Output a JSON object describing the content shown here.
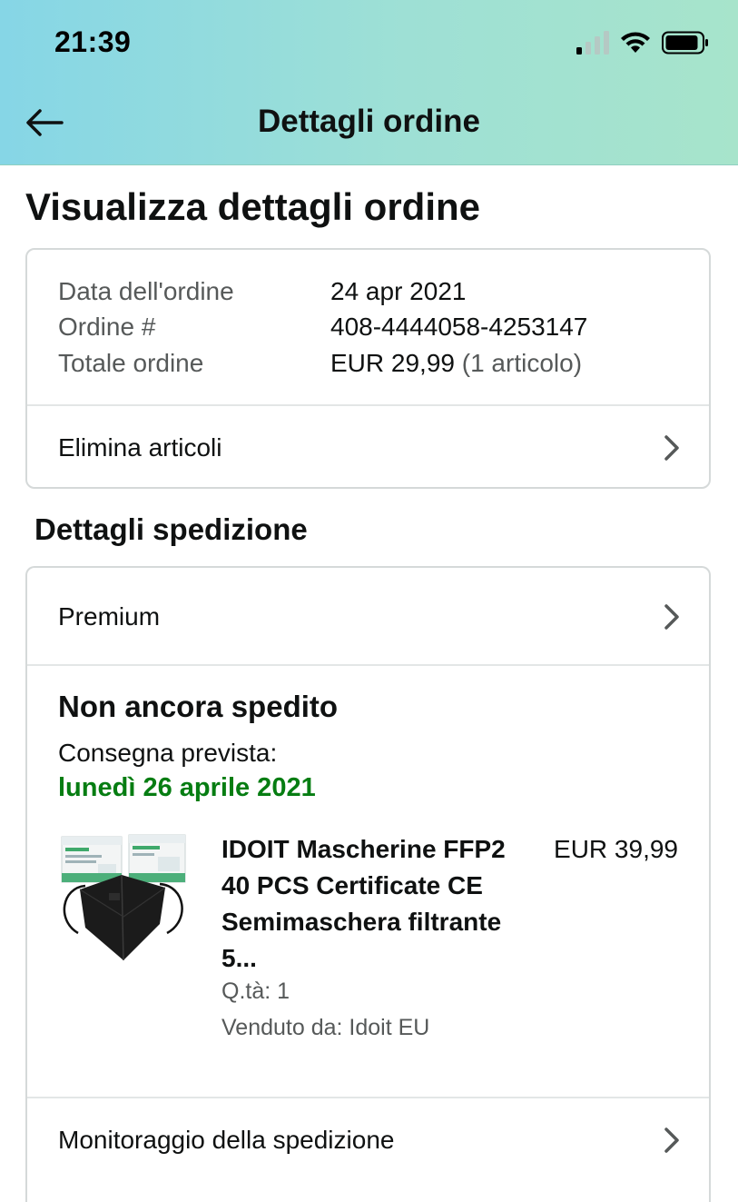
{
  "status_bar": {
    "time": "21:39",
    "signal_icon": "signal-bars-icon",
    "wifi_icon": "wifi-icon",
    "battery_icon": "battery-icon"
  },
  "nav": {
    "title": "Dettagli ordine",
    "back_icon": "back-arrow-icon",
    "background_colors": [
      "#86d6e6",
      "#a7e4cb"
    ]
  },
  "page": {
    "title": "Visualizza dettagli ordine"
  },
  "order_summary": {
    "rows": [
      {
        "label": "Data dell'ordine",
        "value": "24 apr 2021"
      },
      {
        "label": "Ordine #",
        "value": "408-4444058-4253147"
      },
      {
        "label": "Totale ordine",
        "value": "EUR 29,99",
        "note": "(1 articolo)"
      }
    ],
    "delete_items_label": "Elimina articoli"
  },
  "shipping": {
    "section_title": "Dettagli spedizione",
    "shipping_method": "Premium",
    "status": "Non ancora spedito",
    "delivery_label": "Consegna prevista:",
    "delivery_date": "lunedì 26 aprile 2021",
    "delivery_date_color": "#067d12",
    "item": {
      "title": "IDOIT Mascherine FFP2 40 PCS Certificate CE Semimaschera filtrante 5...",
      "price": "EUR 39,99",
      "quantity": "Q.tà: 1",
      "seller": "Venduto da: Idoit EU",
      "image_icon": "ffp2-mask-product-image"
    },
    "tracking_label": "Monitoraggio della spedizione"
  }
}
